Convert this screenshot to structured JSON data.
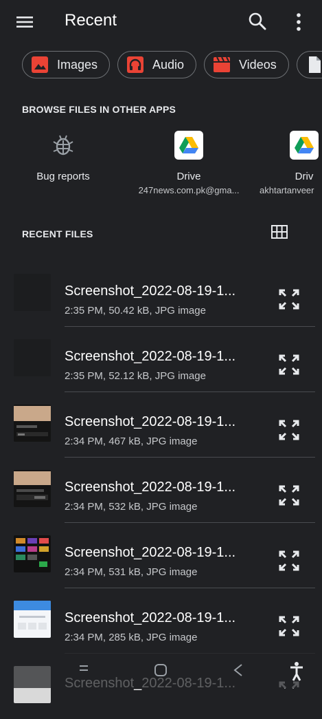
{
  "header": {
    "title": "Recent",
    "menu_icon": "hamburger-menu-icon",
    "search_icon": "search-icon",
    "more_icon": "more-vertical-icon"
  },
  "chips": [
    {
      "label": "Images",
      "icon": "image-icon",
      "color": "#ea4335"
    },
    {
      "label": "Audio",
      "icon": "headphones-icon",
      "color": "#ea4335"
    },
    {
      "label": "Videos",
      "icon": "video-clapper-icon",
      "color": "#ea4335"
    },
    {
      "label": "",
      "icon": "document-icon",
      "color": "#e8eaed"
    }
  ],
  "browse": {
    "heading": "BROWSE FILES IN OTHER APPS",
    "apps": [
      {
        "name": "Bug reports",
        "sub": "",
        "icon": "bug-icon"
      },
      {
        "name": "Drive",
        "sub": "247news.com.pk@gma...",
        "icon": "google-drive-icon"
      },
      {
        "name": "Driv",
        "sub": "akhtartanveer",
        "icon": "google-drive-icon"
      }
    ]
  },
  "recent": {
    "heading": "RECENT FILES",
    "grid_icon": "grid-view-icon",
    "files": [
      {
        "name": "Screenshot_2022-08-19-1...",
        "meta": "2:35 PM, 50.42 kB, JPG image"
      },
      {
        "name": "Screenshot_2022-08-19-1...",
        "meta": "2:35 PM, 52.12 kB, JPG image"
      },
      {
        "name": "Screenshot_2022-08-19-1...",
        "meta": "2:34 PM, 467 kB, JPG image"
      },
      {
        "name": "Screenshot_2022-08-19-1...",
        "meta": "2:34 PM, 532 kB, JPG image"
      },
      {
        "name": "Screenshot_2022-08-19-1...",
        "meta": "2:34 PM, 531 kB, JPG image"
      },
      {
        "name": "Screenshot_2022-08-19-1...",
        "meta": "2:34 PM, 285 kB, JPG image"
      },
      {
        "name": "Screenshot_2022-08-19-1...",
        "meta": ""
      }
    ]
  },
  "colors": {
    "background": "#202124",
    "accent_red": "#ea4335",
    "drive_green": "#0f9d58",
    "drive_yellow": "#fbbc04",
    "drive_blue": "#4285f4"
  }
}
